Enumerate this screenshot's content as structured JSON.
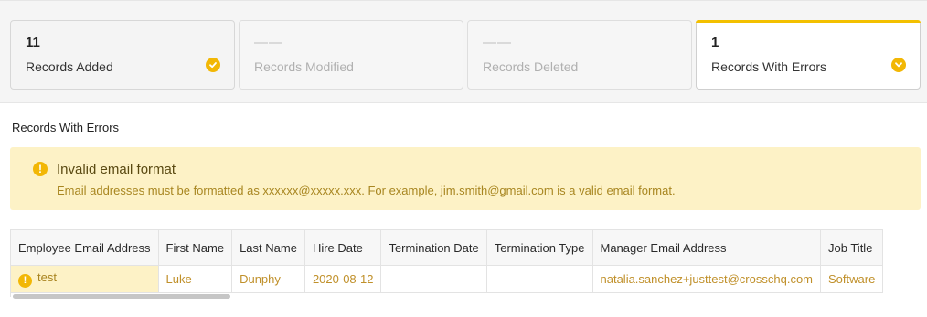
{
  "summary": {
    "cards": [
      {
        "count": "11",
        "label": "Records Added"
      },
      {
        "count": "——",
        "label": "Records Modified"
      },
      {
        "count": "——",
        "label": "Records Deleted"
      },
      {
        "count": "1",
        "label": "Records With Errors"
      }
    ]
  },
  "errors": {
    "section_title": "Records With Errors",
    "alert_title": "Invalid email format",
    "alert_text": "Email addresses must be formatted as xxxxxx@xxxxx.xxx. For example, jim.smith@gmail.com is a valid email format."
  },
  "table": {
    "headers": [
      "Employee Email Address",
      "First Name",
      "Last Name",
      "Hire Date",
      "Termination Date",
      "Termination Type",
      "Manager Email Address",
      "Job Title"
    ],
    "rows": [
      [
        "test",
        "Luke",
        "Dunphy",
        "2020-08-12",
        "——",
        "——",
        "natalia.sanchez+justtest@crosschq.com",
        "Software"
      ]
    ]
  },
  "colors": {
    "accent": "#f2b705",
    "alert_bg": "#fdf2c6",
    "error_text": "#c0902a"
  },
  "icons": [
    "check-circle-icon",
    "alert-circle-icon"
  ]
}
